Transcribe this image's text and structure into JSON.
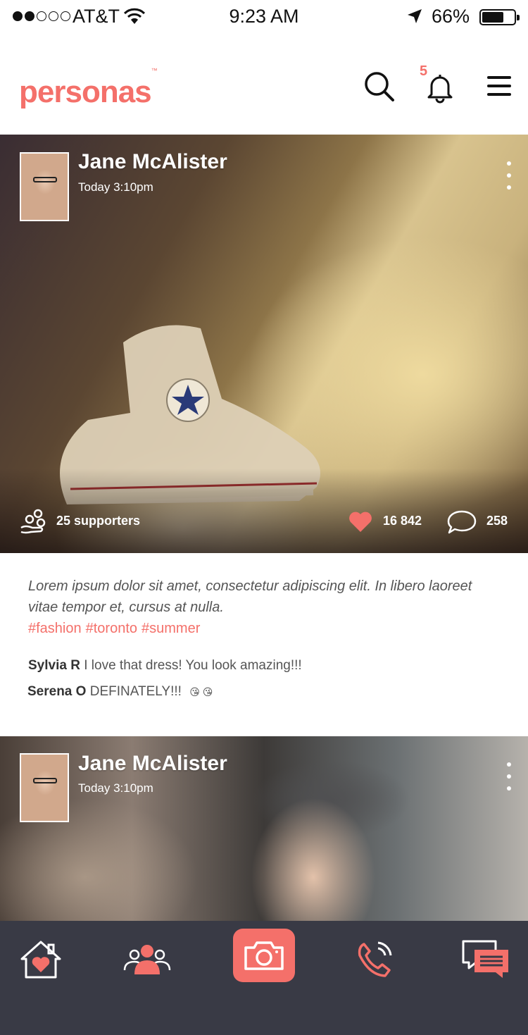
{
  "status_bar": {
    "carrier": "AT&T",
    "time": "9:23 AM",
    "battery": "66%",
    "battery_level": 0.66,
    "signal_bars": 2,
    "signal_total": 5
  },
  "header": {
    "logo": "personas",
    "logo_tm": "™",
    "notification_count": "5",
    "icons": [
      "search-icon",
      "bell-icon",
      "menu-icon"
    ]
  },
  "posts": [
    {
      "author": "Jane McAlister",
      "timestamp": "Today 3:10pm",
      "supporters": "25 supporters",
      "likes": "16 842",
      "comments": "258",
      "caption": "Lorem ipsum dolor sit amet, consectetur adipiscing elit. In libero laoreet vitae tempor et, cursus at nulla.",
      "hashtags": [
        "#fashion",
        "#toronto",
        "#summer"
      ],
      "comment_list": [
        {
          "user": "Sylvia R",
          "text": "I love that dress! You look amazing!!!"
        },
        {
          "user": "Serena O",
          "text": "DEFINATELY!!!",
          "emoji": "😘 😘"
        }
      ]
    },
    {
      "author": "Jane McAlister",
      "timestamp": "Today 3:10pm"
    }
  ],
  "tab_bar": {
    "items": [
      "home-icon",
      "people-icon",
      "camera-icon",
      "calls-icon",
      "messages-icon"
    ],
    "active": "camera"
  },
  "colors": {
    "accent": "#f4706a",
    "tab_bar_bg": "#393a45",
    "text": "#555555"
  }
}
